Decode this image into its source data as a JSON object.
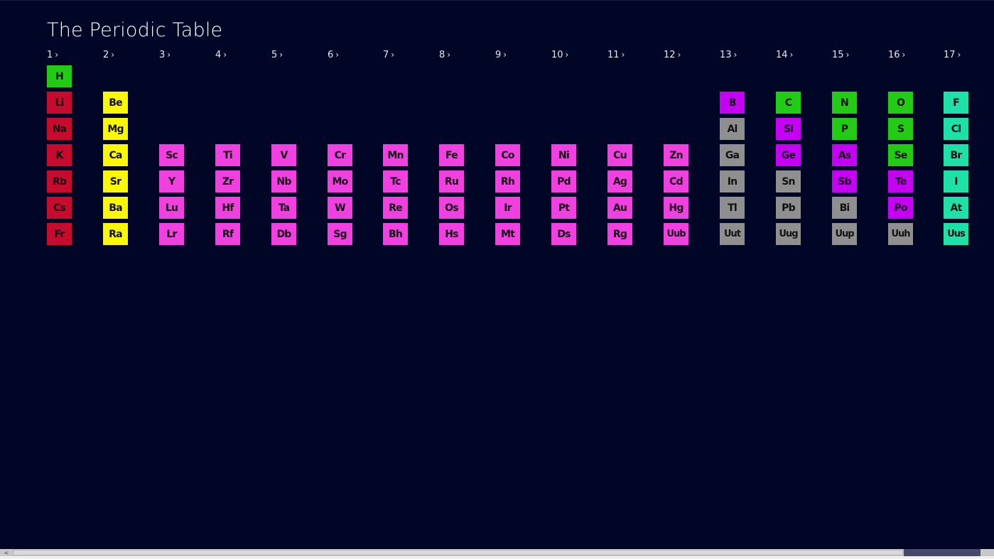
{
  "title": "The Periodic Table",
  "colors": {
    "background": "#020626",
    "alkali": "#c70b2f",
    "alkaline": "#faf707",
    "transition": "#f140e0",
    "metalloid": "#c600f5",
    "nonmetal": "#22cb14",
    "post_transition": "#8f8f8f",
    "halogen": "#1fe0a6"
  },
  "groups": [
    {
      "label": "1",
      "chevron": "›"
    },
    {
      "label": "2",
      "chevron": "›"
    },
    {
      "label": "3",
      "chevron": "›"
    },
    {
      "label": "4",
      "chevron": "›"
    },
    {
      "label": "5",
      "chevron": "›"
    },
    {
      "label": "6",
      "chevron": "›"
    },
    {
      "label": "7",
      "chevron": "›"
    },
    {
      "label": "8",
      "chevron": "›"
    },
    {
      "label": "9",
      "chevron": "›"
    },
    {
      "label": "10",
      "chevron": "›"
    },
    {
      "label": "11",
      "chevron": "›"
    },
    {
      "label": "12",
      "chevron": "›"
    },
    {
      "label": "13",
      "chevron": "›"
    },
    {
      "label": "14",
      "chevron": "›"
    },
    {
      "label": "15",
      "chevron": "›"
    },
    {
      "label": "16",
      "chevron": "›"
    },
    {
      "label": "17",
      "chevron": "›"
    }
  ],
  "elements": [
    {
      "symbol": "H",
      "group": 1,
      "period": 1,
      "category": "nonmetal"
    },
    {
      "symbol": "Li",
      "group": 1,
      "period": 2,
      "category": "alkali"
    },
    {
      "symbol": "Na",
      "group": 1,
      "period": 3,
      "category": "alkali"
    },
    {
      "symbol": "K",
      "group": 1,
      "period": 4,
      "category": "alkali"
    },
    {
      "symbol": "Rb",
      "group": 1,
      "period": 5,
      "category": "alkali"
    },
    {
      "symbol": "Cs",
      "group": 1,
      "period": 6,
      "category": "alkali"
    },
    {
      "symbol": "Fr",
      "group": 1,
      "period": 7,
      "category": "alkali"
    },
    {
      "symbol": "Be",
      "group": 2,
      "period": 2,
      "category": "alkaline"
    },
    {
      "symbol": "Mg",
      "group": 2,
      "period": 3,
      "category": "alkaline"
    },
    {
      "symbol": "Ca",
      "group": 2,
      "period": 4,
      "category": "alkaline"
    },
    {
      "symbol": "Sr",
      "group": 2,
      "period": 5,
      "category": "alkaline"
    },
    {
      "symbol": "Ba",
      "group": 2,
      "period": 6,
      "category": "alkaline"
    },
    {
      "symbol": "Ra",
      "group": 2,
      "period": 7,
      "category": "alkaline"
    },
    {
      "symbol": "Sc",
      "group": 3,
      "period": 4,
      "category": "transition"
    },
    {
      "symbol": "Y",
      "group": 3,
      "period": 5,
      "category": "transition"
    },
    {
      "symbol": "Lu",
      "group": 3,
      "period": 6,
      "category": "transition"
    },
    {
      "symbol": "Lr",
      "group": 3,
      "period": 7,
      "category": "transition"
    },
    {
      "symbol": "Ti",
      "group": 4,
      "period": 4,
      "category": "transition"
    },
    {
      "symbol": "Zr",
      "group": 4,
      "period": 5,
      "category": "transition"
    },
    {
      "symbol": "Hf",
      "group": 4,
      "period": 6,
      "category": "transition"
    },
    {
      "symbol": "Rf",
      "group": 4,
      "period": 7,
      "category": "transition"
    },
    {
      "symbol": "V",
      "group": 5,
      "period": 4,
      "category": "transition"
    },
    {
      "symbol": "Nb",
      "group": 5,
      "period": 5,
      "category": "transition"
    },
    {
      "symbol": "Ta",
      "group": 5,
      "period": 6,
      "category": "transition"
    },
    {
      "symbol": "Db",
      "group": 5,
      "period": 7,
      "category": "transition"
    },
    {
      "symbol": "Cr",
      "group": 6,
      "period": 4,
      "category": "transition"
    },
    {
      "symbol": "Mo",
      "group": 6,
      "period": 5,
      "category": "transition"
    },
    {
      "symbol": "W",
      "group": 6,
      "period": 6,
      "category": "transition"
    },
    {
      "symbol": "Sg",
      "group": 6,
      "period": 7,
      "category": "transition"
    },
    {
      "symbol": "Mn",
      "group": 7,
      "period": 4,
      "category": "transition"
    },
    {
      "symbol": "Tc",
      "group": 7,
      "period": 5,
      "category": "transition"
    },
    {
      "symbol": "Re",
      "group": 7,
      "period": 6,
      "category": "transition"
    },
    {
      "symbol": "Bh",
      "group": 7,
      "period": 7,
      "category": "transition"
    },
    {
      "symbol": "Fe",
      "group": 8,
      "period": 4,
      "category": "transition"
    },
    {
      "symbol": "Ru",
      "group": 8,
      "period": 5,
      "category": "transition"
    },
    {
      "symbol": "Os",
      "group": 8,
      "period": 6,
      "category": "transition"
    },
    {
      "symbol": "Hs",
      "group": 8,
      "period": 7,
      "category": "transition"
    },
    {
      "symbol": "Co",
      "group": 9,
      "period": 4,
      "category": "transition"
    },
    {
      "symbol": "Rh",
      "group": 9,
      "period": 5,
      "category": "transition"
    },
    {
      "symbol": "Ir",
      "group": 9,
      "period": 6,
      "category": "transition"
    },
    {
      "symbol": "Mt",
      "group": 9,
      "period": 7,
      "category": "transition"
    },
    {
      "symbol": "Ni",
      "group": 10,
      "period": 4,
      "category": "transition"
    },
    {
      "symbol": "Pd",
      "group": 10,
      "period": 5,
      "category": "transition"
    },
    {
      "symbol": "Pt",
      "group": 10,
      "period": 6,
      "category": "transition"
    },
    {
      "symbol": "Ds",
      "group": 10,
      "period": 7,
      "category": "transition"
    },
    {
      "symbol": "Cu",
      "group": 11,
      "period": 4,
      "category": "transition"
    },
    {
      "symbol": "Ag",
      "group": 11,
      "period": 5,
      "category": "transition"
    },
    {
      "symbol": "Au",
      "group": 11,
      "period": 6,
      "category": "transition"
    },
    {
      "symbol": "Rg",
      "group": 11,
      "period": 7,
      "category": "transition"
    },
    {
      "symbol": "Zn",
      "group": 12,
      "period": 4,
      "category": "transition"
    },
    {
      "symbol": "Cd",
      "group": 12,
      "period": 5,
      "category": "transition"
    },
    {
      "symbol": "Hg",
      "group": 12,
      "period": 6,
      "category": "transition"
    },
    {
      "symbol": "Uub",
      "group": 12,
      "period": 7,
      "category": "transition"
    },
    {
      "symbol": "B",
      "group": 13,
      "period": 2,
      "category": "metalloid"
    },
    {
      "symbol": "Al",
      "group": 13,
      "period": 3,
      "category": "post_transition"
    },
    {
      "symbol": "Ga",
      "group": 13,
      "period": 4,
      "category": "post_transition"
    },
    {
      "symbol": "In",
      "group": 13,
      "period": 5,
      "category": "post_transition"
    },
    {
      "symbol": "Tl",
      "group": 13,
      "period": 6,
      "category": "post_transition"
    },
    {
      "symbol": "Uut",
      "group": 13,
      "period": 7,
      "category": "post_transition"
    },
    {
      "symbol": "C",
      "group": 14,
      "period": 2,
      "category": "nonmetal"
    },
    {
      "symbol": "Si",
      "group": 14,
      "period": 3,
      "category": "metalloid"
    },
    {
      "symbol": "Ge",
      "group": 14,
      "period": 4,
      "category": "metalloid"
    },
    {
      "symbol": "Sn",
      "group": 14,
      "period": 5,
      "category": "post_transition"
    },
    {
      "symbol": "Pb",
      "group": 14,
      "period": 6,
      "category": "post_transition"
    },
    {
      "symbol": "Uug",
      "group": 14,
      "period": 7,
      "category": "post_transition"
    },
    {
      "symbol": "N",
      "group": 15,
      "period": 2,
      "category": "nonmetal"
    },
    {
      "symbol": "P",
      "group": 15,
      "period": 3,
      "category": "nonmetal"
    },
    {
      "symbol": "As",
      "group": 15,
      "period": 4,
      "category": "metalloid"
    },
    {
      "symbol": "Sb",
      "group": 15,
      "period": 5,
      "category": "metalloid"
    },
    {
      "symbol": "Bi",
      "group": 15,
      "period": 6,
      "category": "post_transition"
    },
    {
      "symbol": "Uup",
      "group": 15,
      "period": 7,
      "category": "post_transition"
    },
    {
      "symbol": "O",
      "group": 16,
      "period": 2,
      "category": "nonmetal"
    },
    {
      "symbol": "S",
      "group": 16,
      "period": 3,
      "category": "nonmetal"
    },
    {
      "symbol": "Se",
      "group": 16,
      "period": 4,
      "category": "nonmetal"
    },
    {
      "symbol": "Te",
      "group": 16,
      "period": 5,
      "category": "metalloid"
    },
    {
      "symbol": "Po",
      "group": 16,
      "period": 6,
      "category": "metalloid"
    },
    {
      "symbol": "Uuh",
      "group": 16,
      "period": 7,
      "category": "post_transition"
    },
    {
      "symbol": "F",
      "group": 17,
      "period": 2,
      "category": "halogen"
    },
    {
      "symbol": "Cl",
      "group": 17,
      "period": 3,
      "category": "halogen"
    },
    {
      "symbol": "Br",
      "group": 17,
      "period": 4,
      "category": "halogen"
    },
    {
      "symbol": "I",
      "group": 17,
      "period": 5,
      "category": "halogen"
    },
    {
      "symbol": "At",
      "group": 17,
      "period": 6,
      "category": "halogen"
    },
    {
      "symbol": "Uus",
      "group": 17,
      "period": 7,
      "category": "halogen"
    }
  ],
  "scrollbar": {
    "left_arrow_icon": "chevron-left-icon",
    "left_arrow_glyph": "<",
    "position_fraction": 0.0,
    "visible_fraction": 0.92
  }
}
